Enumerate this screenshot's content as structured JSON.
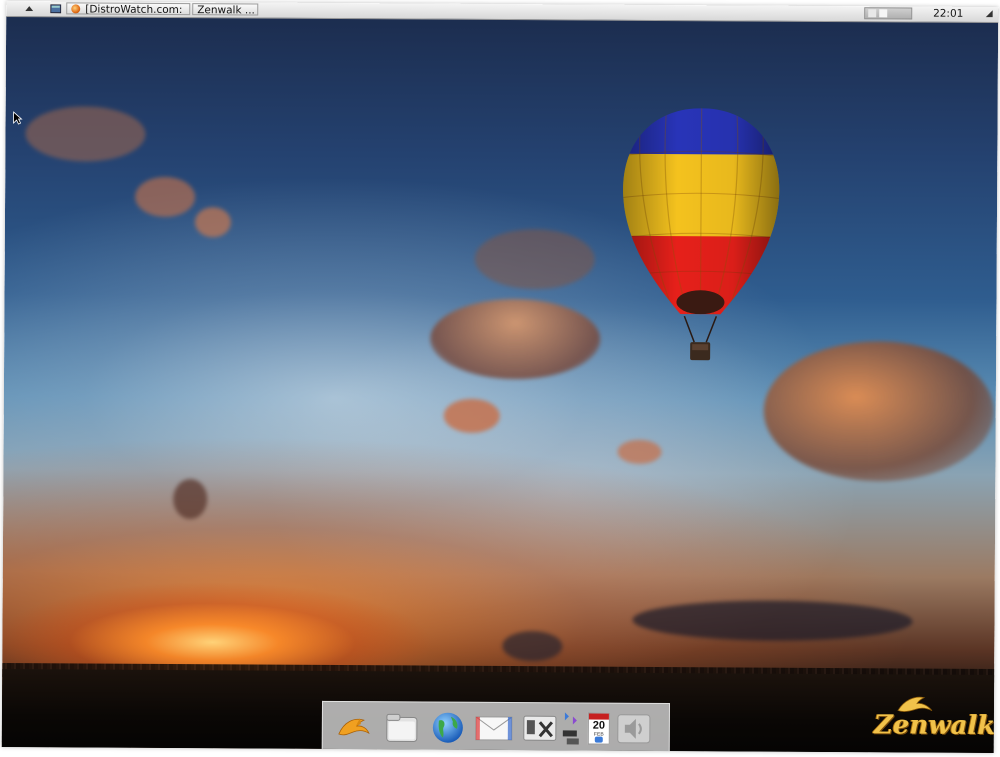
{
  "top_panel": {
    "task_items": [
      {
        "label": "[DistroWatch.com:"
      },
      {
        "label": "Zenwalk ..."
      }
    ],
    "clock": "22:01"
  },
  "dock": {
    "items": [
      {
        "name": "dolphin-launcher-icon"
      },
      {
        "name": "folder-icon"
      },
      {
        "name": "web-browser-icon"
      },
      {
        "name": "mail-icon"
      },
      {
        "name": "settings-tools-icon"
      },
      {
        "name": "network-icon"
      },
      {
        "name": "calendar-icon"
      },
      {
        "name": "volume-speaker-icon"
      }
    ],
    "calendar_day": "20",
    "calendar_month": "FEB"
  },
  "logo": {
    "text": "Zenwalk"
  },
  "colors": {
    "logo_gold": "#f1c24a",
    "panel_bg": "#e4e4e4",
    "dock_bg": "#d2d2d2"
  }
}
